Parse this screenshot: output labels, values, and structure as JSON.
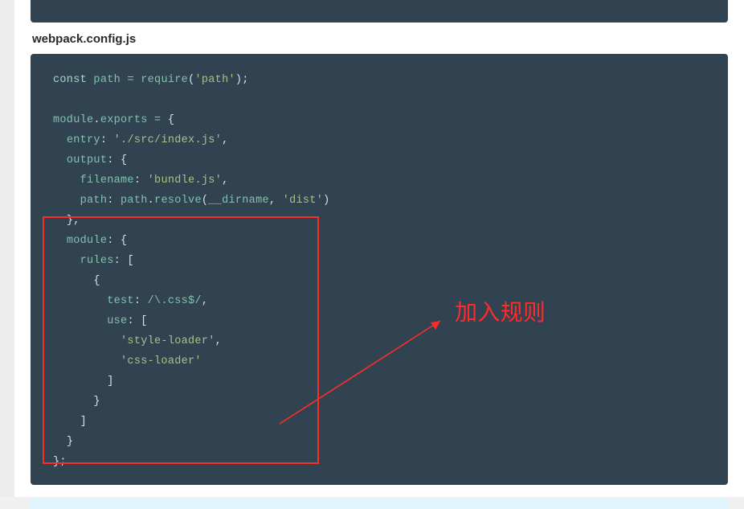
{
  "filename": "webpack.config.js",
  "annotation": "加入规则",
  "code": {
    "lines": [
      {
        "plus": "",
        "text": "const path = require('path');"
      },
      {
        "plus": "",
        "text": ""
      },
      {
        "plus": "",
        "text": "module.exports = {"
      },
      {
        "plus": "",
        "text": "  entry: './src/index.js',"
      },
      {
        "plus": "",
        "text": "  output: {"
      },
      {
        "plus": "",
        "text": "    filename: 'bundle.js',"
      },
      {
        "plus": "",
        "text": "    path: path.resolve(__dirname, 'dist')"
      },
      {
        "plus": "+",
        "text": "  },"
      },
      {
        "plus": "+",
        "text": "  module: {"
      },
      {
        "plus": "+",
        "text": "    rules: ["
      },
      {
        "plus": "+",
        "text": "      {"
      },
      {
        "plus": "+",
        "text": "        test: /\\.css$/,"
      },
      {
        "plus": "+",
        "text": "        use: ["
      },
      {
        "plus": "+",
        "text": "          'style-loader',"
      },
      {
        "plus": "+",
        "text": "          'css-loader'"
      },
      {
        "plus": "+",
        "text": "        ]"
      },
      {
        "plus": "+",
        "text": "      }"
      },
      {
        "plus": "+",
        "text": "    ]"
      },
      {
        "plus": "+",
        "text": "  }"
      },
      {
        "plus": "",
        "text": "};"
      }
    ]
  }
}
